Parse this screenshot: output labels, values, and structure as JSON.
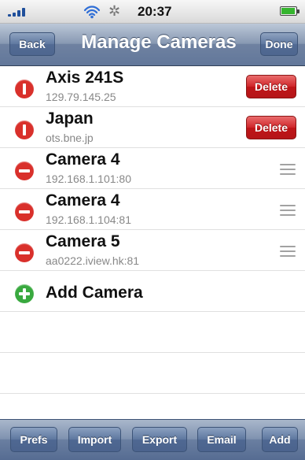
{
  "status_bar": {
    "time": "20:37",
    "icons": {
      "signal": "signal-icon",
      "wifi": "wifi-icon",
      "activity": "gear-icon",
      "battery": "battery-icon"
    }
  },
  "navigation": {
    "back_label": "Back",
    "title": "Manage Cameras",
    "done_label": "Done"
  },
  "cameras": [
    {
      "name": "Axis 241S",
      "address": "129.79.145.25",
      "state": "delete-confirm",
      "delete_label": "Delete"
    },
    {
      "name": "Japan",
      "address": "ots.bne.jp",
      "state": "delete-confirm",
      "delete_label": "Delete"
    },
    {
      "name": "Camera 4",
      "address": "192.168.1.101:80",
      "state": "editable"
    },
    {
      "name": "Camera 4",
      "address": "192.168.1.104:81",
      "state": "editable"
    },
    {
      "name": "Camera 5",
      "address": "aa0222.iview.hk:81",
      "state": "editable"
    }
  ],
  "add_camera": {
    "label": "Add Camera"
  },
  "toolbar": {
    "prefs": "Prefs",
    "import": "Import",
    "export": "Export",
    "email": "Email",
    "add": "Add"
  },
  "colors": {
    "nav_blue": "#6f82a1",
    "delete_red": "#c91d22",
    "add_green": "#39a93f",
    "status_blue": "#1f4f9b"
  }
}
